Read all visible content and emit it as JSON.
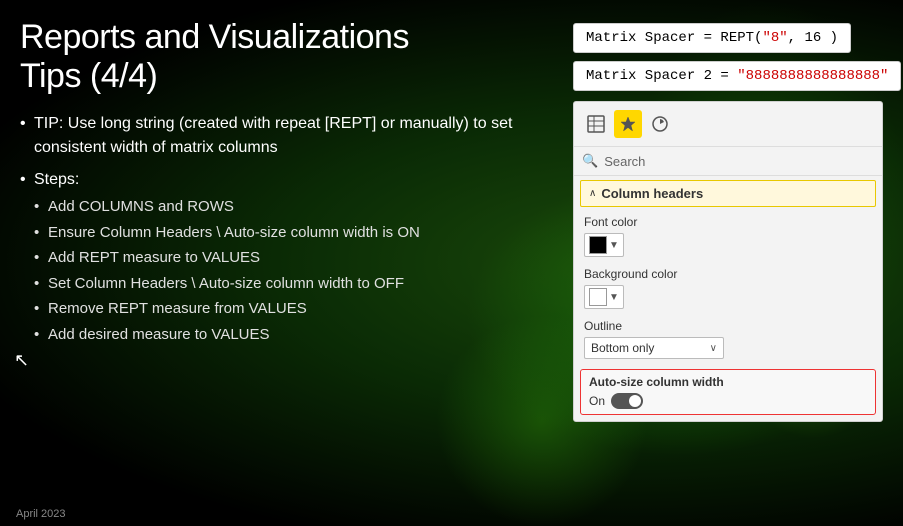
{
  "page": {
    "title_line1": "Reports and Visualizations",
    "title_line2": "Tips (4/4)",
    "footer": "April 2023"
  },
  "bullets": {
    "tip": "TIP: Use long string (created with repeat [REPT] or manually) to set consistent width of matrix columns",
    "steps_label": "Steps:",
    "steps": [
      "Add COLUMNS and ROWS",
      "Ensure Column Headers \\ Auto-size column width is ON",
      "Add REPT measure to VALUES",
      "Set Column Headers \\ Auto-size column width to OFF",
      "Remove REPT measure from VALUES",
      "Add desired measure to VALUES"
    ]
  },
  "formulas": {
    "formula1_prefix": "Matrix Spacer = REPT(",
    "formula1_str": "\"8\"",
    "formula1_suffix": ", 16 )",
    "formula2_prefix": "Matrix Spacer 2 = ",
    "formula2_str": "\"8888888888888888\""
  },
  "pbi_panel": {
    "toolbar": {
      "icons": [
        "table-icon",
        "paint-icon",
        "analytics-icon"
      ]
    },
    "search": {
      "placeholder": "Search",
      "icon": "search-icon"
    },
    "section": {
      "label": "Column headers",
      "chevron": "∧"
    },
    "font_color_label": "Font color",
    "bg_color_label": "Background color",
    "outline_label": "Outline",
    "outline_value": "Bottom only",
    "autosize_label": "Auto-size column width",
    "toggle_label": "On",
    "toggle_state": "on"
  }
}
